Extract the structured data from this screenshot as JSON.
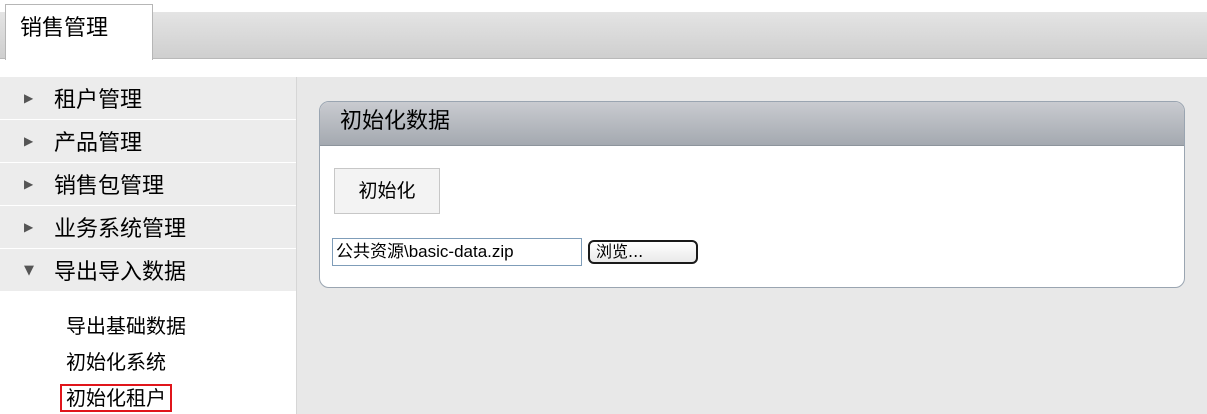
{
  "header": {
    "active_tab": "销售管理"
  },
  "sidebar": {
    "items": [
      {
        "label": "租户管理"
      },
      {
        "label": "产品管理"
      },
      {
        "label": "销售包管理"
      },
      {
        "label": "业务系统管理"
      },
      {
        "label": "导出导入数据"
      }
    ],
    "subitems": [
      {
        "label": "导出基础数据"
      },
      {
        "label": "初始化系统"
      },
      {
        "label": "初始化租户"
      }
    ]
  },
  "panel": {
    "title": "初始化数据",
    "init_button_label": "初始化",
    "file_value": "公共资源\\basic-data.zip",
    "browse_label": "浏览..."
  },
  "colors": {
    "selected_outline": "#e0151b",
    "panel_header": "#a4a9b0",
    "main_background": "#e8e8e8"
  }
}
